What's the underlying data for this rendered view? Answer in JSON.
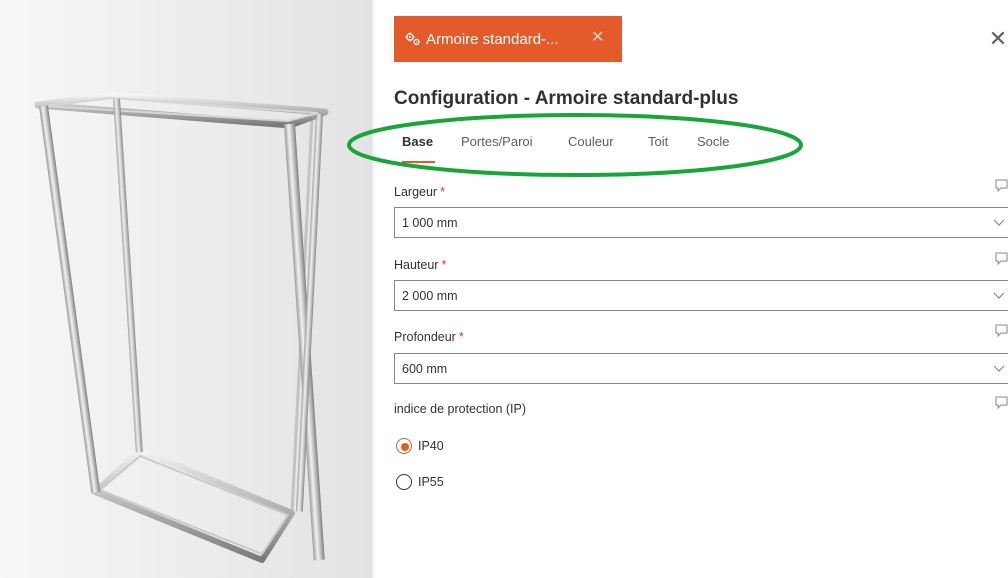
{
  "colors": {
    "accent": "#e35b2b",
    "highlight_ellipse": "#1aa53b",
    "required": "#d13438",
    "border": "#8a8886"
  },
  "tab_chip": {
    "icon": "settings-gears-icon",
    "label": "Armoire standard-...",
    "close_icon": "close-icon"
  },
  "panel_close_icon": "close-icon",
  "title": "Configuration - Armoire standard-plus",
  "tabs": [
    {
      "label": "Base",
      "active": true
    },
    {
      "label": "Portes/Paroi",
      "active": false
    },
    {
      "label": "Couleur",
      "active": false
    },
    {
      "label": "Toit",
      "active": false
    },
    {
      "label": "Socle",
      "active": false
    }
  ],
  "fields": {
    "largeur": {
      "label": "Largeur",
      "required": "*",
      "value": "1 000 mm"
    },
    "hauteur": {
      "label": "Hauteur",
      "required": "*",
      "value": "2 000 mm"
    },
    "profondeur": {
      "label": "Profondeur",
      "required": "*",
      "value": "600 mm"
    }
  },
  "ip": {
    "label": "indice de protection (IP)",
    "options": [
      {
        "label": "IP40",
        "selected": true
      },
      {
        "label": "IP55",
        "selected": false
      }
    ]
  },
  "viewer": {
    "model": "cabinet-frame-3d"
  }
}
